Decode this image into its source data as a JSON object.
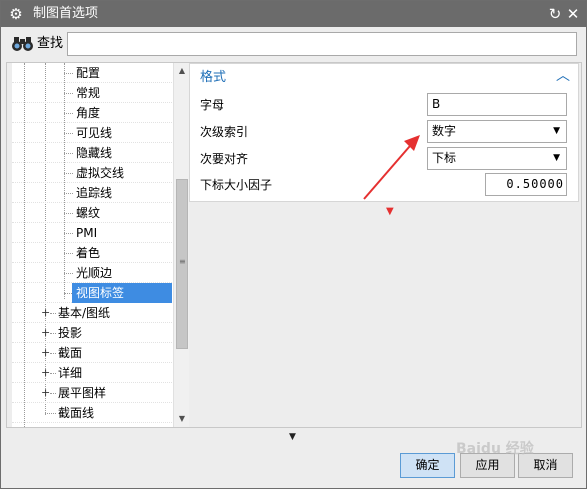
{
  "window": {
    "title": "制图首选项",
    "app_icon": "gear-icon",
    "reset_icon": "refresh-icon",
    "close_icon": "close-icon"
  },
  "search": {
    "label": "查找",
    "icon": "binoculars-icon",
    "value": "",
    "placeholder": ""
  },
  "tree": {
    "children": [
      "配置",
      "常规",
      "角度",
      "可见线",
      "隐藏线",
      "虚拟交线",
      "追踪线",
      "螺纹",
      "PMI",
      "着色",
      "光顺边",
      "视图标签"
    ],
    "selected": "视图标签",
    "top_level": [
      {
        "label": "基本/图纸",
        "expandable": true
      },
      {
        "label": "投影",
        "expandable": true
      },
      {
        "label": "截面",
        "expandable": true
      },
      {
        "label": "详细",
        "expandable": true
      },
      {
        "label": "展平图样",
        "expandable": true
      },
      {
        "label": "截面线",
        "expandable": false
      }
    ],
    "expand_symbol": "+"
  },
  "panel": {
    "section_title": "格式",
    "collapse_icon": "chevron-up-icon",
    "properties": [
      {
        "label": "字母",
        "type": "text",
        "value": "B"
      },
      {
        "label": "次级索引",
        "type": "select",
        "value": "数字"
      },
      {
        "label": "次要对齐",
        "type": "select",
        "value": "下标"
      },
      {
        "label": "下标大小因子",
        "type": "number",
        "value": "0.50000"
      }
    ]
  },
  "buttons": {
    "ok": "确定",
    "apply": "应用",
    "cancel": "取消"
  },
  "watermark": "Baidu 经验",
  "colors": {
    "titlebar": "#6b6b6b",
    "selection": "#3e8ce2",
    "section_title": "#1f6fb7",
    "annotation_arrow": "#e53030"
  }
}
